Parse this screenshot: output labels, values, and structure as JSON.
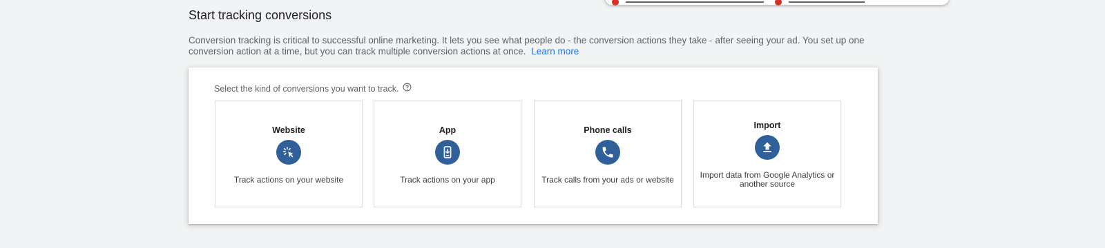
{
  "header": {
    "title": "Start tracking conversions",
    "description": "Conversion tracking is critical to successful online marketing. It lets you see what people do - the conversion actions they take - after seeing your ad. You set up one conversion action at a time, but you can track multiple conversion actions at once.",
    "learn_more_label": "Learn more"
  },
  "selector": {
    "prompt": "Select the kind of conversions you want to track.",
    "help_icon": "help-circle-icon",
    "options": [
      {
        "title": "Website",
        "icon": "cursor-click-icon",
        "description": "Track actions on your website"
      },
      {
        "title": "App",
        "icon": "mobile-download-icon",
        "description": "Track actions on your app"
      },
      {
        "title": "Phone calls",
        "icon": "phone-icon",
        "description": "Track calls from your ads or website"
      },
      {
        "title": "Import",
        "icon": "upload-icon",
        "description": "Import data from Google Analytics or another source"
      }
    ]
  },
  "colors": {
    "accent": "#2f6099",
    "link": "#1a73e8",
    "background": "#f1f3f4"
  }
}
